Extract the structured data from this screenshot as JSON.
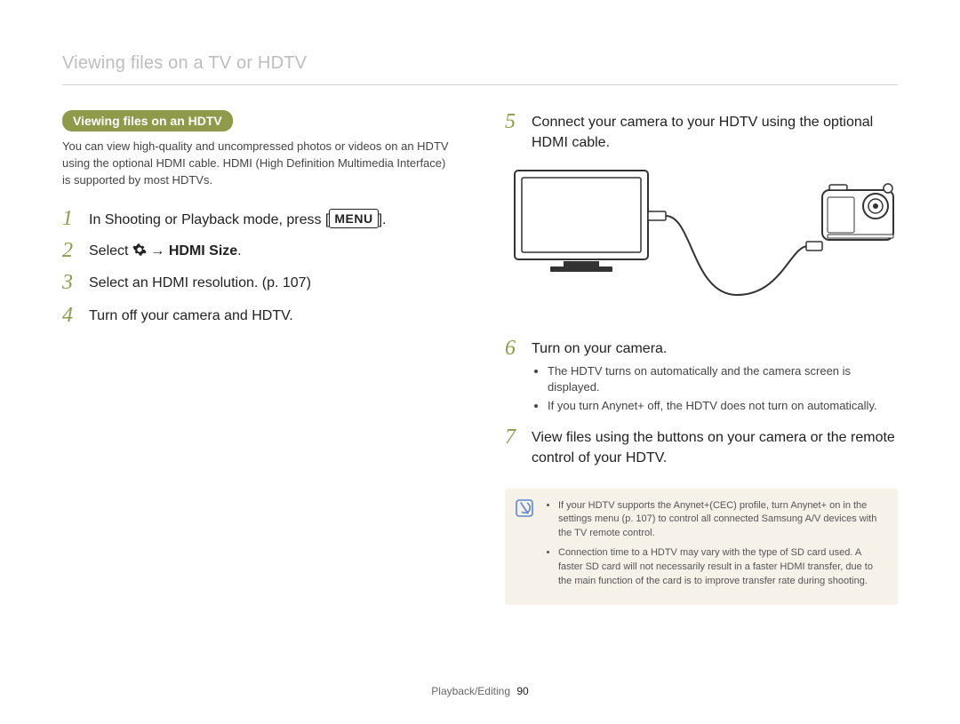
{
  "page_title": "Viewing files on a TV or HDTV",
  "section_pill": "Viewing files on an HDTV",
  "intro": "You can view high-quality and uncompressed photos or videos on an HDTV using the optional HDMI cable. HDMI (High Definition Multimedia Interface) is supported by most HDTVs.",
  "left_steps": {
    "s1": {
      "num": "1",
      "pre": "In Shooting or Playback mode, press [",
      "menu": "MENU",
      "post": "]."
    },
    "s2": {
      "num": "2",
      "select": "Select ",
      "arrow": " → ",
      "hdmi": "HDMI Size",
      "end": "."
    },
    "s3": {
      "num": "3",
      "text": "Select an HDMI resolution. (p. 107)"
    },
    "s4": {
      "num": "4",
      "text": "Turn off your camera and HDTV."
    }
  },
  "right_steps": {
    "s5": {
      "num": "5",
      "text": "Connect your camera to your HDTV using the optional HDMI cable."
    },
    "s6": {
      "num": "6",
      "text": "Turn on your camera.",
      "bullets": [
        "The HDTV turns on automatically and the camera screen is displayed.",
        "If you turn Anynet+ off, the HDTV does not turn on automatically."
      ]
    },
    "s7": {
      "num": "7",
      "text": "View files using the buttons on your camera or the remote control of your HDTV."
    }
  },
  "note_bullets": [
    "If your HDTV supports the Anynet+(CEC) profile, turn Anynet+ on in the settings menu (p. 107) to control all connected Samsung A/V devices with the TV remote control.",
    "Connection time to a HDTV may vary with the type of SD card used. A faster SD card will not necessarily result in a faster HDMI transfer, due to the main function of the card is to improve transfer rate during shooting."
  ],
  "footer": {
    "section": "Playback/Editing",
    "page": "90"
  },
  "icons": {
    "gear": "gear-icon",
    "note": "note-variant-icon"
  }
}
